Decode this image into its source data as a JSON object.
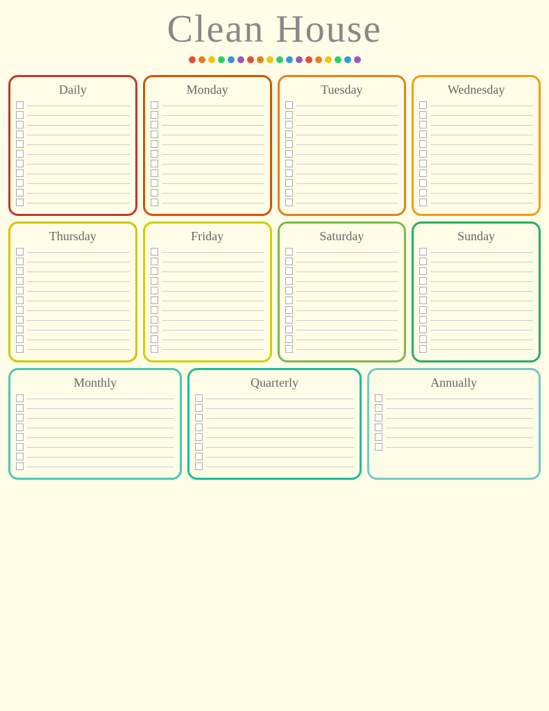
{
  "header": {
    "title": "Clean House"
  },
  "dots": {
    "colors": [
      "#e74c3c",
      "#e67e22",
      "#f1c40f",
      "#2ecc71",
      "#3498db",
      "#9b59b6",
      "#e74c3c",
      "#e67e22",
      "#f1c40f",
      "#2ecc71",
      "#3498db",
      "#9b59b6",
      "#e74c3c",
      "#e67e22",
      "#f1c40f",
      "#2ecc71",
      "#3498db",
      "#9b59b6"
    ]
  },
  "sections": {
    "daily": {
      "label": "Daily",
      "rows": 11
    },
    "monday": {
      "label": "Monday",
      "rows": 11
    },
    "tuesday": {
      "label": "Tuesday",
      "rows": 11
    },
    "wednesday": {
      "label": "Wednesday",
      "rows": 11
    },
    "thursday": {
      "label": "Thursday",
      "rows": 11
    },
    "friday": {
      "label": "Friday",
      "rows": 11
    },
    "saturday": {
      "label": "Saturday",
      "rows": 11
    },
    "sunday": {
      "label": "Sunday",
      "rows": 11
    },
    "monthly": {
      "label": "Monthly",
      "rows": 8
    },
    "quarterly": {
      "label": "Quarterly",
      "rows": 8
    },
    "annually": {
      "label": "Annually",
      "rows": 6
    }
  }
}
